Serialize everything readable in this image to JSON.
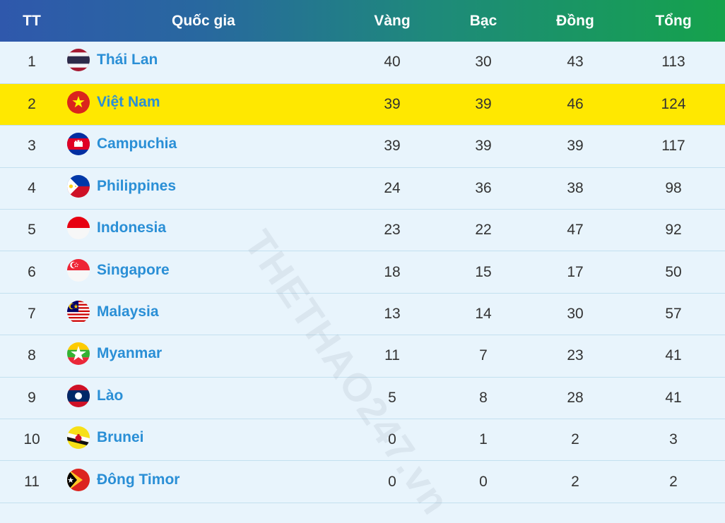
{
  "header": {
    "rank": "TT",
    "country": "Quốc gia",
    "gold": "Vàng",
    "silver": "Bạc",
    "bronze": "Đồng",
    "total": "Tổng"
  },
  "watermark": "THETHAO247.vn",
  "highlight_color": "#ffe800",
  "rows": [
    {
      "rank": "1",
      "country": "Thái Lan",
      "flag": "thailand-flag-icon",
      "gold": "40",
      "silver": "30",
      "bronze": "43",
      "total": "113"
    },
    {
      "rank": "2",
      "country": "Việt Nam",
      "flag": "vietnam-flag-icon",
      "gold": "39",
      "silver": "39",
      "bronze": "46",
      "total": "124"
    },
    {
      "rank": "3",
      "country": "Campuchia",
      "flag": "cambodia-flag-icon",
      "gold": "39",
      "silver": "39",
      "bronze": "39",
      "total": "117"
    },
    {
      "rank": "4",
      "country": "Philippines",
      "flag": "philippines-flag-icon",
      "gold": "24",
      "silver": "36",
      "bronze": "38",
      "total": "98"
    },
    {
      "rank": "5",
      "country": "Indonesia",
      "flag": "indonesia-flag-icon",
      "gold": "23",
      "silver": "22",
      "bronze": "47",
      "total": "92"
    },
    {
      "rank": "6",
      "country": "Singapore",
      "flag": "singapore-flag-icon",
      "gold": "18",
      "silver": "15",
      "bronze": "17",
      "total": "50"
    },
    {
      "rank": "7",
      "country": "Malaysia",
      "flag": "malaysia-flag-icon",
      "gold": "13",
      "silver": "14",
      "bronze": "30",
      "total": "57"
    },
    {
      "rank": "8",
      "country": "Myanmar",
      "flag": "myanmar-flag-icon",
      "gold": "11",
      "silver": "7",
      "bronze": "23",
      "total": "41"
    },
    {
      "rank": "9",
      "country": "Lào",
      "flag": "laos-flag-icon",
      "gold": "5",
      "silver": "8",
      "bronze": "28",
      "total": "41"
    },
    {
      "rank": "10",
      "country": "Brunei",
      "flag": "brunei-flag-icon",
      "gold": "0",
      "silver": "1",
      "bronze": "2",
      "total": "3"
    },
    {
      "rank": "11",
      "country": "Đông Timor",
      "flag": "east-timor-flag-icon",
      "gold": "0",
      "silver": "0",
      "bronze": "2",
      "total": "2"
    }
  ]
}
